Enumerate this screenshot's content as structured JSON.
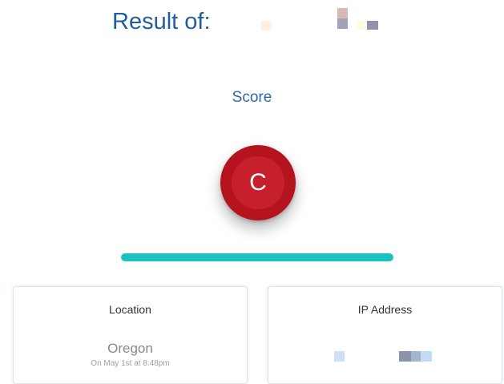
{
  "header": {
    "title": "Result of:"
  },
  "score": {
    "label": "Score",
    "grade": "C",
    "grade_color": "#c7202c",
    "progress_fraction": 1.0,
    "progress_color": "#18c2bd"
  },
  "cards": {
    "location": {
      "heading": "Location",
      "value": "Oregon",
      "timestamp": "On May 1st at 8:48pm"
    },
    "ip": {
      "heading": "IP Address"
    }
  },
  "colors": {
    "title": "#1f5f9f",
    "accent_blue": "#2b6aa8"
  }
}
